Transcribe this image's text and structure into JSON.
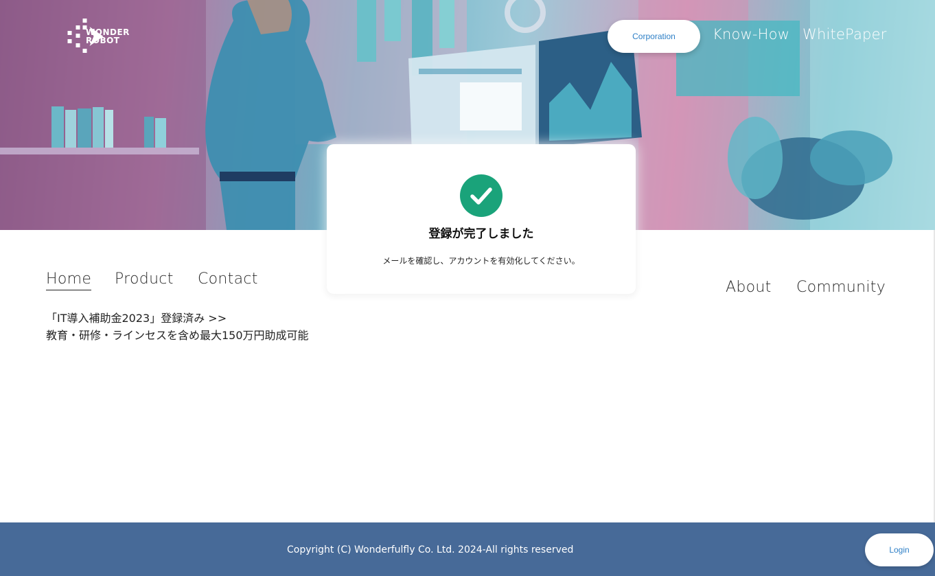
{
  "brand": {
    "line1": "WONDER",
    "line2": "ROBOT"
  },
  "header": {
    "corporation_label": "Corporation",
    "links": [
      "Know-How",
      "WhitePaper"
    ]
  },
  "nav": {
    "left": [
      "Home",
      "Product",
      "Contact"
    ],
    "right": [
      "About",
      "Community"
    ],
    "active": "Home"
  },
  "promo": {
    "line1": "「IT導入補助金2023」登録済み >>",
    "line2": "教育・研修・ラインセスを含め最大150万円助成可能"
  },
  "modal": {
    "icon": "check-circle-icon",
    "title": "登録が完了しました",
    "message": "メールを確認し、アカウントを有効化してください。"
  },
  "footer": {
    "copyright": "Copyright (C) Wonderfulfly Co. Ltd. 2024-All rights reserved",
    "login_label": "Login"
  },
  "colors": {
    "success": "#1aa37a",
    "footer_bg": "#476a98",
    "button_text": "#2d7fc6"
  }
}
